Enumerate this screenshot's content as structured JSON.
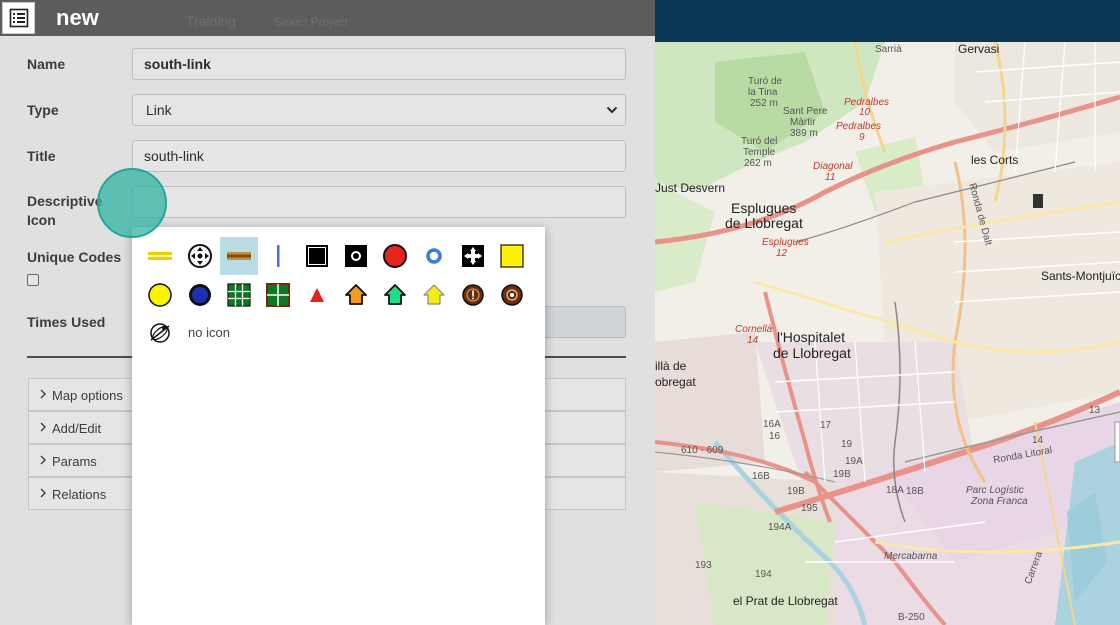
{
  "header": {
    "title": "new",
    "ghost_training": "Training",
    "ghost_select_project": "Select Project"
  },
  "form": {
    "name_label": "Name",
    "name_value": "south-link",
    "type_label": "Type",
    "type_value": "Link",
    "title_label": "Title",
    "title_value": "south-link",
    "icon_label_line1": "Descriptive",
    "icon_label_line2": "Icon",
    "unique_codes_label": "Unique Codes",
    "times_used_label": "Times Used"
  },
  "accordion": {
    "items": [
      "Map options",
      "Add/Edit",
      "Params",
      "Relations"
    ]
  },
  "picker": {
    "no_icon_label": "no icon",
    "selected_index": 2,
    "icons": [
      "yellow-dash-icon",
      "move-cross-icon",
      "brown-dash-icon",
      "blue-bar-icon",
      "black-square-icon",
      "black-square-dot-icon",
      "red-circle-icon",
      "blue-ring-icon",
      "black-arrows-square-icon",
      "yellow-square-icon",
      "yellow-circle-icon",
      "blue-circle-icon",
      "green-grid-square-icon",
      "green-cross-square-icon",
      "red-triangle-icon",
      "orange-house-icon",
      "green-house-icon",
      "yellow-house-icon",
      "brown-exclaim-circle-icon",
      "brown-dot-circle-icon",
      "no-icon-icon"
    ]
  },
  "map": {
    "labels": {
      "gervasi": "Gervasi",
      "sarria": "Sarrià",
      "turo_tina": "Turó de",
      "turo_tina2": "la Tina",
      "turo_tina3": "252 m",
      "sant_pere": "Sant Pere",
      "sant_pere2": "Màrtir",
      "sant_pere3": "389 m",
      "turo_temple": "Turó del",
      "turo_temple2": "Temple",
      "turo_temple3": "262 m",
      "pedralbes1": "Pedralbes",
      "pedralbes1n": "10",
      "pedralbes2": "Pedralbes",
      "pedralbes2n": "9",
      "diagonal": "Diagonal",
      "diagonal_n": "11",
      "just_desvern": "Just Desvern",
      "esplugues": "Esplugues",
      "de_llobregat": "de Llobregat",
      "esplugues_stop": "Esplugues",
      "esplugues_n": "12",
      "les_corts": "les Corts",
      "sants_montjuic": "Sants-Montjuïc",
      "cornella": "Cornellà",
      "cornella_n": "14",
      "hospitalet": "l'Hospitalet",
      "hospitalet2": "de Llobregat",
      "illa_de": "illà de",
      "illa_de2": "obregat",
      "ronda_litoral": "Ronda Litoral",
      "parc_logistic": "Parc Logístic",
      "zona_franca": "Zona Franca",
      "mercabarna": "Mercabarna",
      "el_prat": "el Prat de Llobregat",
      "b250": "B-250",
      "n16a": "16A",
      "n16": "16",
      "n17": "17",
      "n19a": "19A",
      "n19b": "19B",
      "n18a": "18A",
      "n18b": "18B",
      "n19": "19",
      "n13": "13",
      "n14": "14",
      "n610": "610 - 609",
      "n16b": "16B",
      "n19b2": "19B",
      "n195": "195",
      "n194a": "194A",
      "n193": "193",
      "n194": "194",
      "ronda_dalt": "Ronda de Dalt",
      "carrera": "Carrera"
    }
  }
}
